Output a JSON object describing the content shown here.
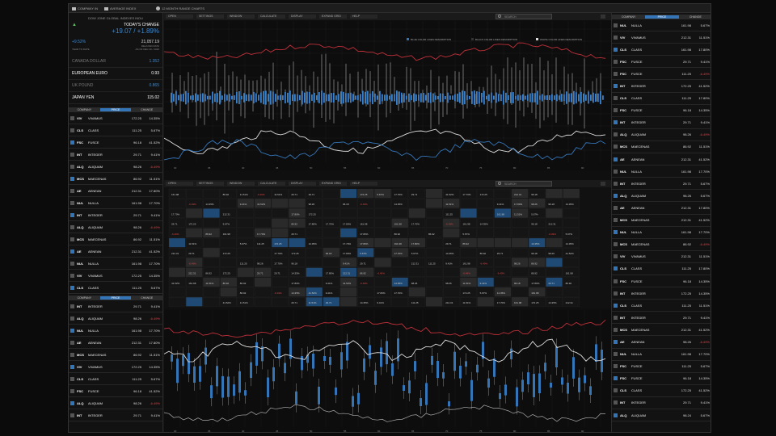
{
  "topbar": {
    "item1": "COMPANY IN",
    "item2": "AVERAGE INDEX",
    "item3": "12 MONTH RANGE CHARTS"
  },
  "left": {
    "index_name": "DOW JONE GLOBAL INDEXES INDU",
    "change_title": "TODAY'S CHANGE",
    "change_value": "+19.07 / +1.89%",
    "pct": "+9.52%",
    "value": "21,057.19",
    "sub1": "DELAYED DATA",
    "ytd": "YEAR TO DATE",
    "asof": "AS OF DEC 20 / 2020",
    "fx": [
      {
        "name": "CANADA DOLLAR",
        "value": "1.352",
        "dim": true
      },
      {
        "name": "EUROPEAN EURO",
        "value": "0.93",
        "dim": false
      },
      {
        "name": "UK POUND",
        "value": "0.865",
        "dim": true
      },
      {
        "name": "JAPAN YEN",
        "value": "115.02",
        "dim": false
      }
    ],
    "tabs": [
      "COMPANY",
      "PRICE",
      "CHANGE"
    ],
    "rows": [
      {
        "ab": "VIV",
        "nm": "VIVAMUS",
        "pr": "172.25",
        "pc": "14.35%"
      },
      {
        "ab": "CLS",
        "nm": "CLASS",
        "pr": "111.25",
        "pc": "5.67%"
      },
      {
        "ab": "FSC",
        "nm": "FUSCE",
        "pr": "96.18",
        "pc": "41.52%"
      },
      {
        "ab": "INT",
        "nm": "INTEGER",
        "pr": "29.71",
        "pc": "9.41%"
      },
      {
        "ab": "ALQ",
        "nm": "ALIQUAM",
        "pr": "98.26",
        "pc": "-6.49%"
      },
      {
        "ab": "MCS",
        "nm": "MAECENAS",
        "pr": "86.92",
        "pc": "11.51%"
      },
      {
        "ab": "AE",
        "nm": "AENEAN",
        "pr": "212.31",
        "pc": "17.80%"
      },
      {
        "ab": "NUL",
        "nm": "NULLA",
        "pr": "161.98",
        "pc": "17.70%"
      },
      {
        "ab": "INT",
        "nm": "INTEGER",
        "pr": "29.71",
        "pc": "9.41%"
      },
      {
        "ab": "ALQ",
        "nm": "ALIQUAM",
        "pr": "98.26",
        "pc": "-6.49%"
      },
      {
        "ab": "MCS",
        "nm": "MAECENAS",
        "pr": "86.92",
        "pc": "11.51%"
      },
      {
        "ab": "AE",
        "nm": "AENEAN",
        "pr": "212.31",
        "pc": "41.52%"
      },
      {
        "ab": "NUL",
        "nm": "NULLA",
        "pr": "161.98",
        "pc": "17.70%"
      },
      {
        "ab": "VIV",
        "nm": "VIVAMUS",
        "pr": "172.25",
        "pc": "14.35%"
      },
      {
        "ab": "CLS",
        "nm": "CLASS",
        "pr": "111.25",
        "pc": "5.67%"
      }
    ],
    "rows2": [
      {
        "ab": "INT",
        "nm": "INTEGER",
        "pr": "29.71",
        "pc": "9.41%"
      },
      {
        "ab": "ALQ",
        "nm": "ALIQUAM",
        "pr": "98.26",
        "pc": "-6.49%"
      },
      {
        "ab": "NUL",
        "nm": "NULLA",
        "pr": "161.98",
        "pc": "17.70%"
      },
      {
        "ab": "AE",
        "nm": "AENEAN",
        "pr": "212.31",
        "pc": "17.80%"
      },
      {
        "ab": "MCS",
        "nm": "MAECENAS",
        "pr": "86.92",
        "pc": "11.51%"
      },
      {
        "ab": "VIV",
        "nm": "VIVAMUS",
        "pr": "172.25",
        "pc": "14.35%"
      },
      {
        "ab": "CLS",
        "nm": "CLASS",
        "pr": "111.25",
        "pc": "5.67%"
      },
      {
        "ab": "FSC",
        "nm": "FUSCE",
        "pr": "96.18",
        "pc": "41.52%"
      },
      {
        "ab": "ALQ",
        "nm": "ALIQUAM",
        "pr": "98.26",
        "pc": "-6.49%"
      },
      {
        "ab": "INT",
        "nm": "INTEGER",
        "pr": "29.71",
        "pc": "9.41%"
      }
    ]
  },
  "menu": {
    "items": [
      "OPEN",
      "SETTINGS",
      "WINDOW",
      "CALCULATE",
      "DISPLAY",
      "EXPAND GRID",
      "HELP"
    ],
    "search": "SEARCH"
  },
  "legend": [
    "BLUE COLOR LINES DESCRIPTION",
    "BLACK COLOR LINES DESCRIPTION",
    "WHITE COLOR LINES DESCRIPTION"
  ],
  "axis_ticks": [
    "30",
    "35",
    "40",
    "45",
    "50",
    "55",
    "60",
    "65",
    "70",
    "75",
    "80",
    "85",
    "90"
  ],
  "grid": {
    "col_labels": [
      "VIV",
      "INT",
      "ALQ",
      "MCS",
      "AE",
      "NUL",
      "CLS",
      "FSC",
      "VIV",
      "INT",
      "ALQ",
      "MCS"
    ],
    "values": [
      "172.25",
      "-6.49%",
      "161.98",
      "14.35%",
      "5.67%",
      "17.70%",
      "111.25",
      "29.71",
      "9.41%",
      "98.26",
      "41.52%",
      "212.31",
      "86.92",
      "11.51%",
      "17.80%",
      "96.18"
    ]
  },
  "right": {
    "tabs": [
      "COMPANY",
      "PRICE",
      "CHANGE"
    ],
    "rows": [
      {
        "ab": "NUL",
        "nm": "NULLA",
        "pr": "161.98",
        "pc": "5.67%"
      },
      {
        "ab": "VIV",
        "nm": "VIVAMUS",
        "pr": "212.31",
        "pc": "11.51%"
      },
      {
        "ab": "CLS",
        "nm": "CLASS",
        "pr": "161.98",
        "pc": "17.80%"
      },
      {
        "ab": "FSC",
        "nm": "FUSCE",
        "pr": "29.71",
        "pc": "9.41%"
      },
      {
        "ab": "FSC",
        "nm": "FUSCE",
        "pr": "111.25",
        "pc": "-6.49%"
      },
      {
        "ab": "INT",
        "nm": "INTEGER",
        "pr": "172.25",
        "pc": "41.52%"
      },
      {
        "ab": "CLS",
        "nm": "CLASS",
        "pr": "111.25",
        "pc": "17.80%"
      },
      {
        "ab": "FSC",
        "nm": "FUSCE",
        "pr": "96.18",
        "pc": "14.35%"
      },
      {
        "ab": "INT",
        "nm": "INTEGER",
        "pr": "29.71",
        "pc": "9.41%"
      },
      {
        "ab": "ALQ",
        "nm": "ALIQUAM",
        "pr": "98.26",
        "pc": "-6.49%"
      },
      {
        "ab": "MCS",
        "nm": "MAECENAS",
        "pr": "86.92",
        "pc": "11.51%"
      },
      {
        "ab": "AE",
        "nm": "AENEAN",
        "pr": "212.31",
        "pc": "41.52%"
      },
      {
        "ab": "NUL",
        "nm": "NULLA",
        "pr": "161.98",
        "pc": "17.70%"
      },
      {
        "ab": "INT",
        "nm": "INTEGER",
        "pr": "29.71",
        "pc": "5.67%"
      },
      {
        "ab": "ALQ",
        "nm": "ALIQUAM",
        "pr": "98.26",
        "pc": "5.67%"
      },
      {
        "ab": "AE",
        "nm": "AENEAN",
        "pr": "212.31",
        "pc": "17.80%"
      },
      {
        "ab": "MCS",
        "nm": "MAECENAS",
        "pr": "212.31",
        "pc": "41.52%"
      },
      {
        "ab": "NUL",
        "nm": "NULLA",
        "pr": "161.98",
        "pc": "17.70%"
      },
      {
        "ab": "MCS",
        "nm": "MAECENAS",
        "pr": "86.92",
        "pc": "-6.49%"
      },
      {
        "ab": "VIV",
        "nm": "VIVAMUS",
        "pr": "212.31",
        "pc": "11.51%"
      },
      {
        "ab": "CLS",
        "nm": "CLASS",
        "pr": "111.25",
        "pc": "17.80%"
      },
      {
        "ab": "FSC",
        "nm": "FUSCE",
        "pr": "96.18",
        "pc": "14.35%"
      },
      {
        "ab": "INT",
        "nm": "INTEGER",
        "pr": "172.25",
        "pc": "14.35%"
      },
      {
        "ab": "CLS",
        "nm": "CLASS",
        "pr": "111.25",
        "pc": "11.51%"
      },
      {
        "ab": "INT",
        "nm": "INTEGER",
        "pr": "29.71",
        "pc": "9.41%"
      },
      {
        "ab": "MCS",
        "nm": "MAECENAS",
        "pr": "212.31",
        "pc": "41.52%"
      },
      {
        "ab": "AE",
        "nm": "AENEAN",
        "pr": "98.26",
        "pc": "-6.49%"
      },
      {
        "ab": "NUL",
        "nm": "NULLA",
        "pr": "161.98",
        "pc": "17.70%"
      },
      {
        "ab": "FSC",
        "nm": "FUSCE",
        "pr": "111.25",
        "pc": "5.67%"
      },
      {
        "ab": "FSC",
        "nm": "FUSCE",
        "pr": "96.18",
        "pc": "14.35%"
      },
      {
        "ab": "CLS",
        "nm": "CLASS",
        "pr": "172.25",
        "pc": "41.52%"
      },
      {
        "ab": "INT",
        "nm": "INTEGER",
        "pr": "29.71",
        "pc": "9.41%"
      },
      {
        "ab": "ALQ",
        "nm": "ALIQUAM",
        "pr": "98.24",
        "pc": "5.67%"
      }
    ]
  },
  "colors": {
    "blue": "#3475b8",
    "red": "#c0303a",
    "bg": "#0f0f0f"
  }
}
